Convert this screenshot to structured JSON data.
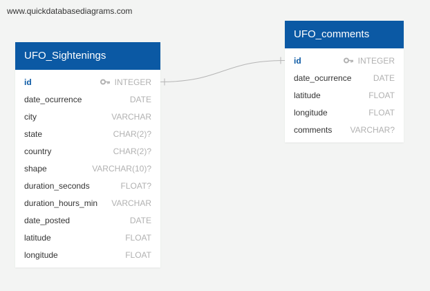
{
  "watermark": "www.quickdatabasediagrams.com",
  "colors": {
    "header": "#0b59a4",
    "pk_text": "#0b59a4",
    "type_text": "#b1b1b1",
    "connector": "#b5b5b5"
  },
  "tables": [
    {
      "name": "UFO_Sightenings",
      "fields": [
        {
          "name": "id",
          "type": "INTEGER",
          "pk": true,
          "icon": "key-icon"
        },
        {
          "name": "date_ocurrence",
          "type": "DATE"
        },
        {
          "name": "city",
          "type": "VARCHAR"
        },
        {
          "name": "state",
          "type": "CHAR(2)?"
        },
        {
          "name": "country",
          "type": "CHAR(2)?"
        },
        {
          "name": "shape",
          "type": "VARCHAR(10)?"
        },
        {
          "name": "duration_seconds",
          "type": "FLOAT?"
        },
        {
          "name": "duration_hours_min",
          "type": "VARCHAR"
        },
        {
          "name": "date_posted",
          "type": "DATE"
        },
        {
          "name": "latitude",
          "type": "FLOAT"
        },
        {
          "name": "longitude",
          "type": "FLOAT"
        }
      ]
    },
    {
      "name": "UFO_comments",
      "fields": [
        {
          "name": "id",
          "type": "INTEGER",
          "pk": true,
          "icon": "key-icon"
        },
        {
          "name": "date_ocurrence",
          "type": "DATE"
        },
        {
          "name": "latitude",
          "type": "FLOAT"
        },
        {
          "name": "longitude",
          "type": "FLOAT"
        },
        {
          "name": "comments",
          "type": "VARCHAR?"
        }
      ]
    }
  ],
  "relationship": {
    "from": "UFO_Sightenings.id",
    "to": "UFO_comments.id",
    "type": "one-to-one"
  }
}
